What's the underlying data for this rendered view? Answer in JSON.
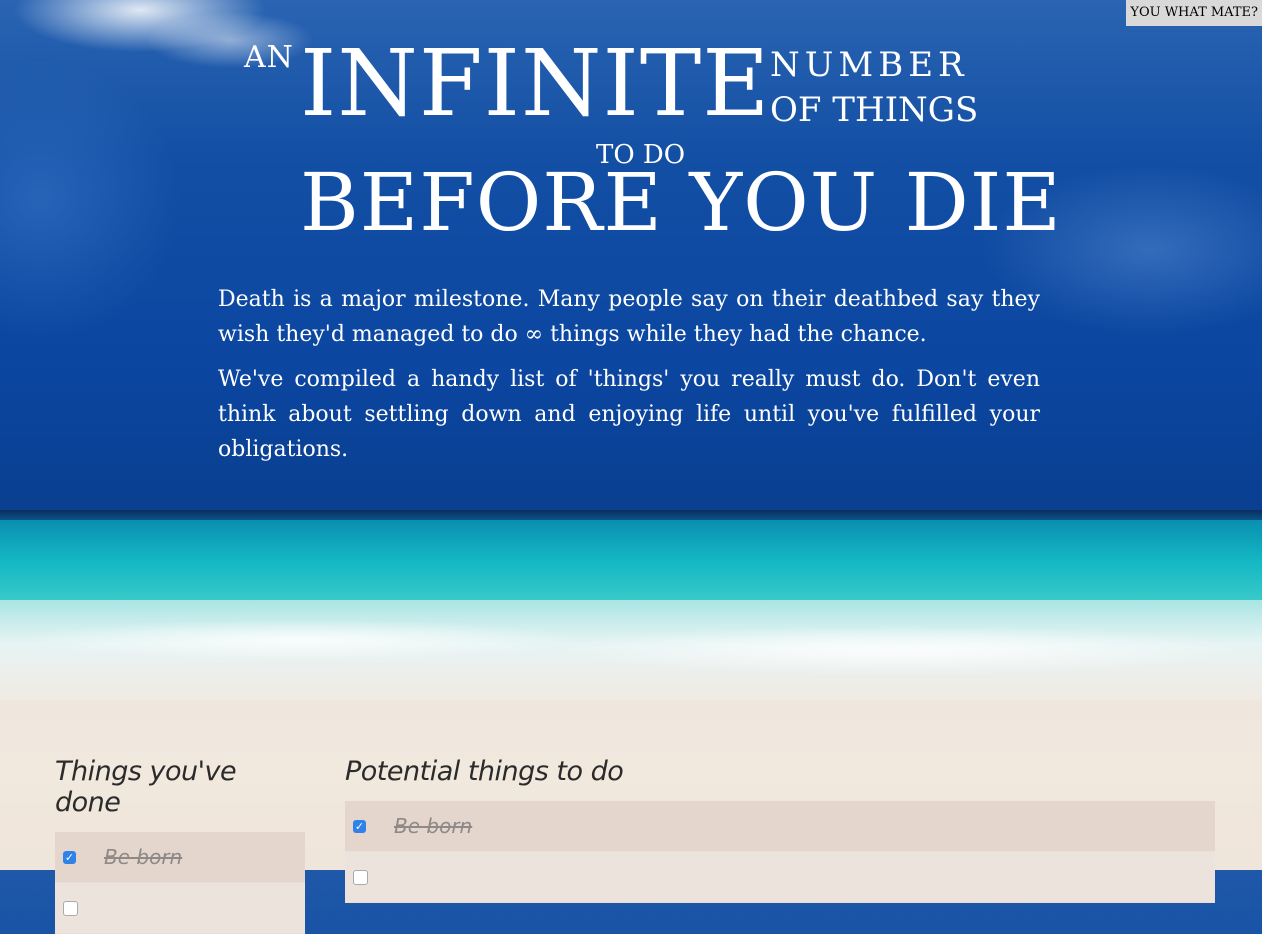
{
  "corner_button": {
    "label": "YOU WHAT MATE?"
  },
  "title": {
    "an": "AN",
    "infinite": "INFINITE",
    "number": "NUMBER",
    "of_things": "OF THINGS",
    "to_do": "TO DO",
    "before": "BEFORE YOU DIE"
  },
  "intro": {
    "p1": "Death is a major milestone. Many people say on their deathbed say they wish they'd managed to do ∞ things while they had the chance.",
    "p2": "We've compiled a handy list of 'things' you really must do. Don't even think about settling down and enjoying life until you've fulfilled your obligations."
  },
  "done": {
    "heading": "Things you've done",
    "items": [
      {
        "label": "Be born",
        "checked": true
      },
      {
        "label": "",
        "checked": false
      }
    ]
  },
  "potential": {
    "heading": "Potential things to do",
    "items": [
      {
        "label": "Be born",
        "checked": true
      },
      {
        "label": "",
        "checked": false
      }
    ]
  },
  "colors": {
    "checkbox": "#2f83e8",
    "row": "#e4d6cc",
    "title_text": "#ffffff"
  }
}
